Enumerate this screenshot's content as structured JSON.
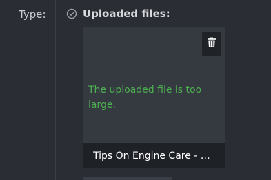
{
  "form": {
    "type_label": "Type:",
    "uploaded_label": "Uploaded files:"
  },
  "file_card": {
    "error_message": "The uploaded file is too large.",
    "file_name": "Tips On Engine Care - C...",
    "delete_icon": "trash-icon",
    "status_icon": "check-circle-icon"
  },
  "colors": {
    "background": "#2a2d33",
    "card_background": "#353a41",
    "error_text": "#4caf50",
    "file_bar": "#1e2126"
  }
}
